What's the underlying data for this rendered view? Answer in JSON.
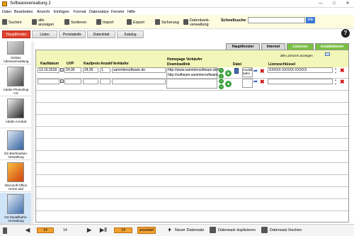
{
  "window": {
    "title": "Softwareverwaltung 2"
  },
  "menu": [
    "Datei",
    "Bearbeiten",
    "Ansicht",
    "Einfügen",
    "Format",
    "Datensätze",
    "Fenster",
    "Hilfe"
  ],
  "toolbar": {
    "items": [
      {
        "label": "Suchen"
      },
      {
        "label": "alle anzeigen"
      },
      {
        "label": "Sortieren"
      },
      {
        "label": "Import"
      },
      {
        "label": "Export"
      },
      {
        "label": "Sicherung"
      },
      {
        "label": "Datenbank-verwaltung"
      }
    ],
    "search_label": "Schnellsuche",
    "search_value": "",
    "go_label": "Alle"
  },
  "nav_tabs": [
    "Hauptfenster",
    "Listen",
    "Preistabelle",
    "Datenblatt",
    "Katalog"
  ],
  "sidebar_items": [
    "DVDes Adressverwaltung",
    "Adobe Photoshop CS",
    "Adobe Acrobat",
    "GS Briefmarken-Verwaltung",
    "Microsoft Office Home and",
    "GS Modellbahn-Verwaltung"
  ],
  "subtabs": [
    "Hauptfenster",
    "Internet",
    "Lizenzen",
    "Installationen"
  ],
  "license_link": "alle Lizenzen anzeigen",
  "columns": {
    "kaufdatum": "Kaufdatum",
    "uvp": "UVP",
    "kaufpreis": "Kaufpreis",
    "anzahl": "Anzahl",
    "verkaeufer": "Verkäufer",
    "homepage": "Homepage Verkäufer",
    "downloadlink": "Downloadlink",
    "datei": "Datei",
    "lizenz": "Lizenzschlüssel"
  },
  "row": {
    "kaufdatum": "13.10.2018",
    "uvp": "24,95",
    "kaufpreis": "24,95",
    "anzahl": "1",
    "verkaeufer": "sammlersoftware.de",
    "homepage": "http://www.sammlersoftware.de/GS-",
    "downloadlink": "http://software.sammlersoftware.",
    "datei": "modell bahn",
    "lizenz": "XXXXX-XXXXX-XXXXX"
  },
  "status": {
    "record": "14",
    "total": "14",
    "found": "14",
    "sort_state": "unsortiert",
    "new_label": "Neuer Datensatz",
    "dup_label": "Datensatz duplizieren",
    "del_label": "Datensatz löschen"
  },
  "colors": {
    "accent": "#e04530",
    "green": "#7ac043",
    "orange": "#f0a030",
    "header_bg": "#f2f6b8"
  }
}
